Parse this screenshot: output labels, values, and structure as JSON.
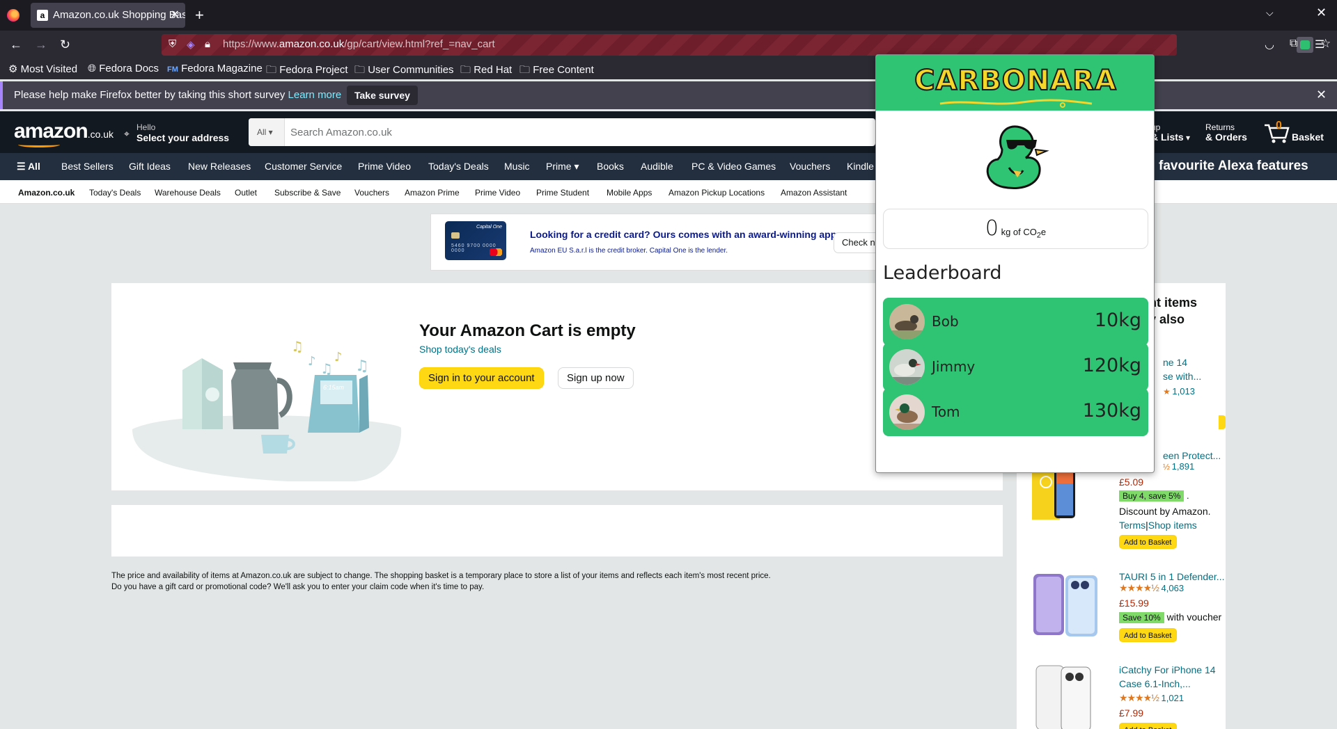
{
  "browser": {
    "tab_title": "Amazon.co.uk Shopping Basket",
    "url_prefix": "https://www.",
    "url_domain": "amazon.co.uk",
    "url_path": "/gp/cart/view.html?ref_=nav_cart",
    "bookmarks": [
      "Most Visited",
      "Fedora Docs",
      "Fedora Magazine",
      "Fedora Project",
      "User Communities",
      "Red Hat",
      "Free Content"
    ],
    "notification": {
      "message": "Please help make Firefox better by taking this short survey",
      "learn_more": "Learn more",
      "button": "Take survey"
    }
  },
  "amazon": {
    "logo": "amazon",
    "logo_suffix": ".co.uk",
    "address_hello": "Hello",
    "address_select": "Select your address",
    "search_category": "All",
    "search_placeholder": "Search Amazon.co.uk",
    "lists_top": "up",
    "lists_label": "& Lists",
    "returns_top": "Returns",
    "returns_label": "& Orders",
    "cart_count": "0",
    "cart_label": "Basket",
    "nav": [
      "All",
      "Best Sellers",
      "Gift Ideas",
      "New Releases",
      "Customer Service",
      "Prime Video",
      "Today's Deals",
      "Music",
      "Prime",
      "Books",
      "Audible",
      "PC & Video Games",
      "Vouchers",
      "Kindle"
    ],
    "alexa_banner": "favourite Alexa features",
    "subnav": [
      "Amazon.co.uk",
      "Today's Deals",
      "Warehouse Deals",
      "Outlet",
      "Subscribe & Save",
      "Vouchers",
      "Amazon Prime",
      "Prime Video",
      "Prime Student",
      "Mobile Apps",
      "Amazon Pickup Locations",
      "Amazon Assistant"
    ],
    "promo": {
      "title": "Looking for a credit card? Ours comes with an award-winning app.",
      "subtitle": "Amazon EU S.a.r.l is the credit broker. Capital One is the lender.",
      "button": "Check n",
      "card_brand": "Capital One",
      "card_number": "5460 9700 0000 0000"
    },
    "cart": {
      "title": "Your Amazon Cart is empty",
      "deals_link": "Shop today's deals",
      "sign_in": "Sign in to your account",
      "sign_up": "Sign up now",
      "illus_clock": "6:15am"
    },
    "disclaimer_1": "The price and availability of items at Amazon.co.uk are subject to change. The shopping basket is a temporary place to store a list of your items and reflects each item's most recent price.",
    "disclaimer_2": "Do you have a gift card or promotional code? We'll ask you to enter your claim code when it's time to pay.",
    "sidebar": {
      "heading_1": "ht items",
      "heading_2": "y also",
      "items": [
        {
          "title_1": "ne 14",
          "title_2": "se with...",
          "stars": "★★★★½",
          "reviews": "1,013"
        },
        {
          "title_1": "een Protect...",
          "reviews": "1,891",
          "price": "£5.09",
          "badge": "Buy 4, save 5%",
          "badge_after": ".",
          "discount": "Discount by Amazon.",
          "terms": "Terms",
          "shop": "Shop items",
          "basket": "Add to Basket"
        },
        {
          "title_1": "TAURI 5 in 1 Defender...",
          "stars": "★★★★½",
          "reviews": "4,063",
          "price": "£15.99",
          "badge": "Save 10%",
          "badge_after": "with voucher",
          "basket": "Add to Basket"
        },
        {
          "title_1": "iCatchy For iPhone 14",
          "title_2": "Case 6.1-Inch,...",
          "stars": "★★★★½",
          "reviews": "1,021",
          "price": "£7.99",
          "basket": "Add to Basket"
        }
      ]
    }
  },
  "carbonara": {
    "title": "CARBONARA",
    "co2_value": "0",
    "co2_unit_prefix": "kg of CO",
    "co2_sub": "2",
    "co2_suffix": "e",
    "leaderboard_title": "Leaderboard",
    "leaderboard": [
      {
        "name": "Bob",
        "kg": "10kg"
      },
      {
        "name": "Jimmy",
        "kg": "120kg"
      },
      {
        "name": "Tom",
        "kg": "130kg"
      }
    ]
  },
  "colors": {
    "amazon_dark": "#131921",
    "amazon_nav": "#232f3e",
    "carbonara_green": "#2fc374",
    "amazon_yellow": "#ffd814"
  }
}
